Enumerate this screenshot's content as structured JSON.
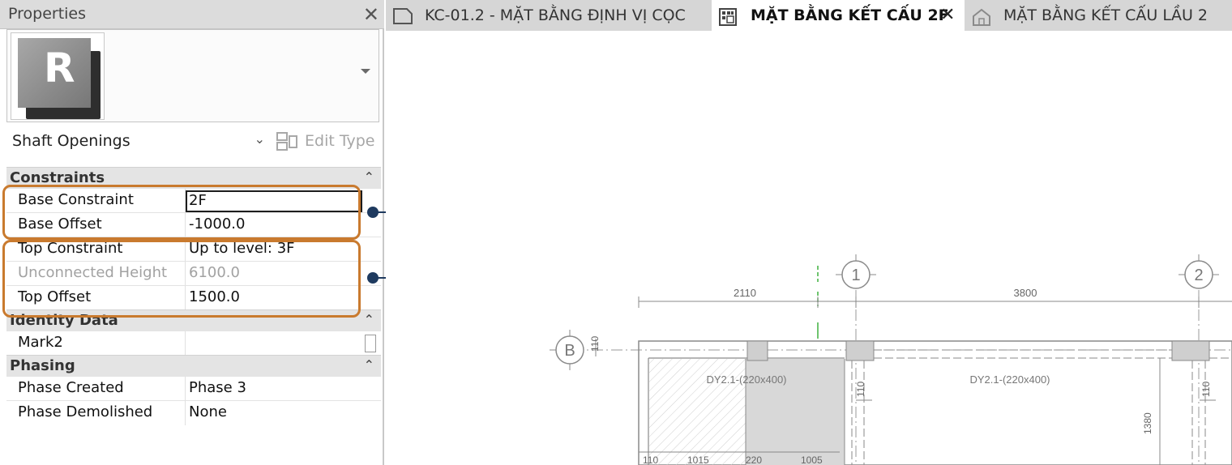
{
  "properties_panel": {
    "title": "Properties",
    "type_selector": {
      "logo_letter": "R"
    },
    "family": "Shaft Openings",
    "edit_type_label": "Edit Type",
    "sections": [
      {
        "name": "Constraints",
        "rows": [
          {
            "label": "Base Constraint",
            "value": "2F",
            "editing": true
          },
          {
            "label": "Base Offset",
            "value": "-1000.0"
          },
          {
            "label": "Top Constraint",
            "value": "Up to level: 3F"
          },
          {
            "label": "Unconnected Height",
            "value": "6100.0",
            "disabled": true
          },
          {
            "label": "Top Offset",
            "value": "1500.0"
          }
        ]
      },
      {
        "name": "Identity Data",
        "rows": [
          {
            "label": "Mark2",
            "value": ""
          }
        ]
      },
      {
        "name": "Phasing",
        "rows": [
          {
            "label": "Phase Created",
            "value": "Phase 3"
          },
          {
            "label": "Phase Demolished",
            "value": "None"
          }
        ]
      }
    ]
  },
  "tabs": [
    {
      "label": "KC-01.2 - MẶT BẰNG ĐỊNH VỊ CỌC",
      "icon": "sheet-icon",
      "active": false
    },
    {
      "label": "MẶT BẰNG KẾT CẤU 2F",
      "icon": "plan-icon",
      "active": true
    },
    {
      "label": "MẶT BẰNG KẾT CẤU LẦU 2",
      "icon": "house-icon",
      "active": false
    }
  ],
  "callouts": [
    "1",
    "2"
  ],
  "drawing": {
    "grids": [
      "1",
      "2",
      "B"
    ],
    "dimensions": [
      "2110",
      "3800",
      "110",
      "110",
      "110",
      "1380",
      "110",
      "1015",
      "220",
      "1005"
    ],
    "beam_labels": [
      "DY2.1-(220x400)",
      "DY2.1-(220x400)"
    ]
  },
  "colors": {
    "highlight": "#c97a2e",
    "callout": "#1e3a5f"
  }
}
